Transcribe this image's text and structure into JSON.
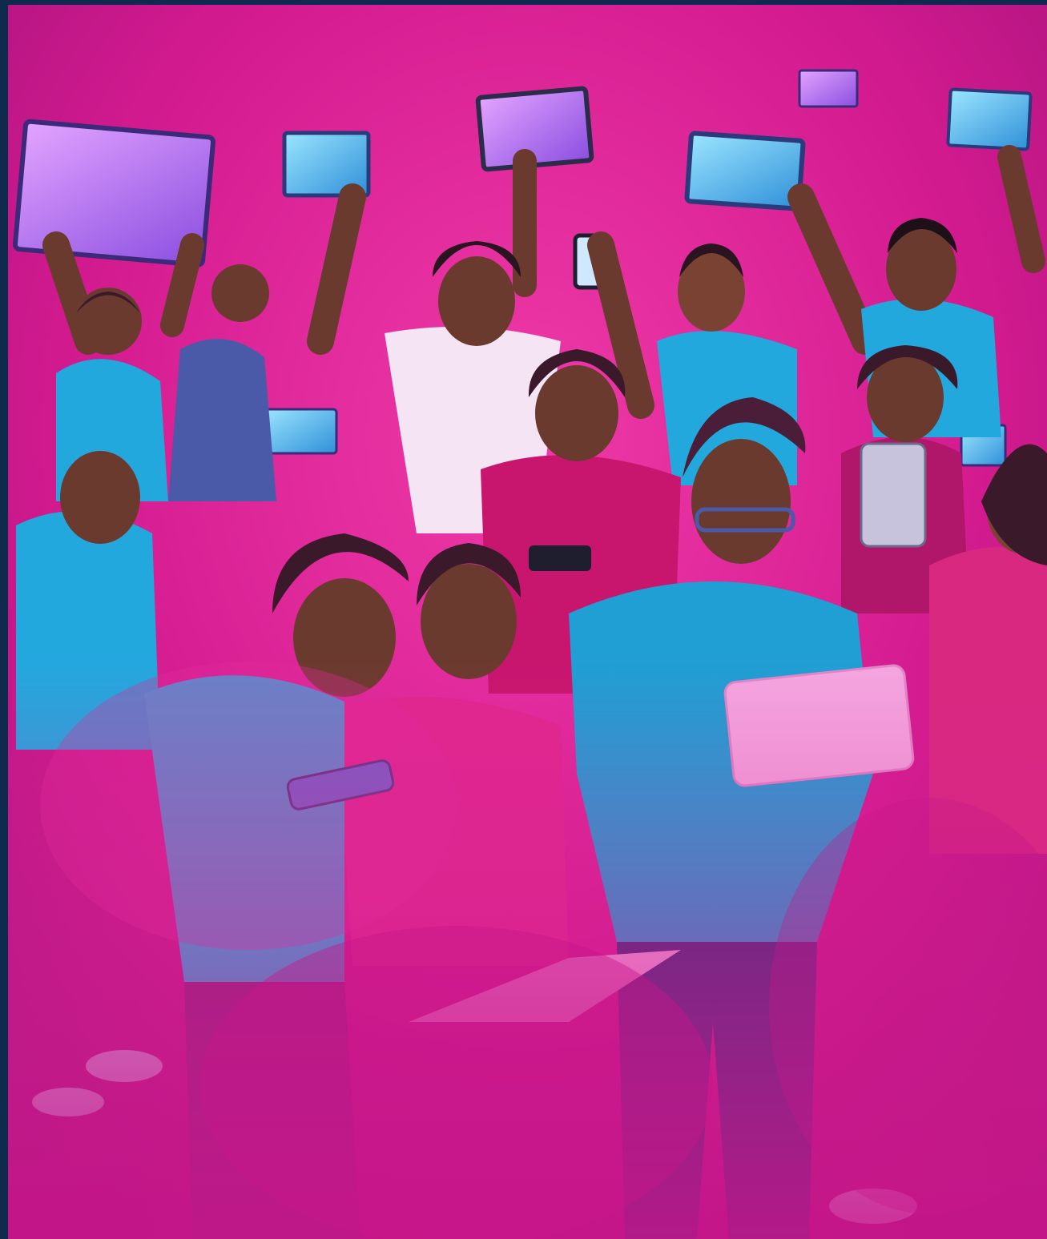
{
  "scene": {
    "subject": "group-of-people-with-devices",
    "colors": {
      "background": "#d21a8f",
      "background_light": "#f03aa8",
      "border": "#0f2a4d",
      "screen_glow": "#6fd3ff",
      "screen_purple": "#b86ef0",
      "shirt_blue": "#23a8de",
      "shirt_pink": "#e0268e",
      "skin": "#6b3a2e",
      "skin_light": "#8a4c3a",
      "hair": "#3a1a2a",
      "pants": "#3b2a7a",
      "laptop": "#f4a6e0"
    }
  }
}
